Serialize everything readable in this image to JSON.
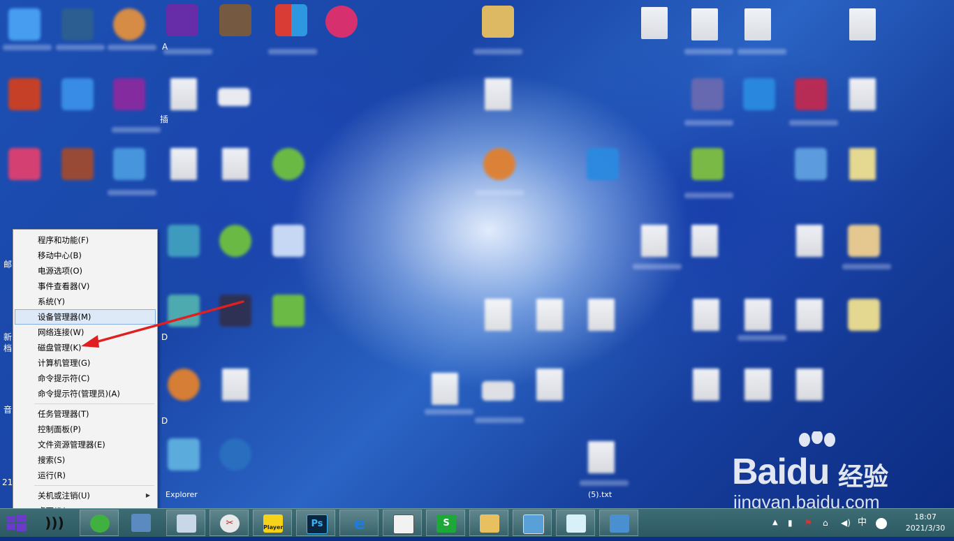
{
  "context_menu": {
    "groups": [
      [
        "程序和功能(F)",
        "移动中心(B)",
        "电源选项(O)",
        "事件查看器(V)",
        "系统(Y)",
        "设备管理器(M)",
        "网络连接(W)",
        "磁盘管理(K)",
        "计算机管理(G)",
        "命令提示符(C)",
        "命令提示符(管理员)(A)"
      ],
      [
        "任务管理器(T)",
        "控制面板(P)",
        "文件资源管理器(E)",
        "搜索(S)",
        "运行(R)"
      ],
      [
        "关机或注销(U)",
        "桌面(D)"
      ]
    ],
    "highlighted_item": "设备管理器(M)",
    "annotated_item": "磁盘管理(K)"
  },
  "desktop": {
    "partial_labels": [
      "A",
      "插",
      "邮",
      "新",
      "档",
      "音",
      "D",
      "D",
      "21",
      "Explorer",
      "(5).txt"
    ]
  },
  "taskbar": {
    "player_label": "Player",
    "ps_label": "Ps",
    "wps_label": "S",
    "ime_label": "中",
    "clock_time": "18:07",
    "clock_date": "2021/3/30"
  },
  "watermark": {
    "brand": "Baidu",
    "jingyan": "经验",
    "url": "jingyan.baidu.com"
  },
  "colors": {
    "menu_highlight": "#dde9f7",
    "arrow": "#e02020",
    "taskbar": "#3d6c74"
  }
}
